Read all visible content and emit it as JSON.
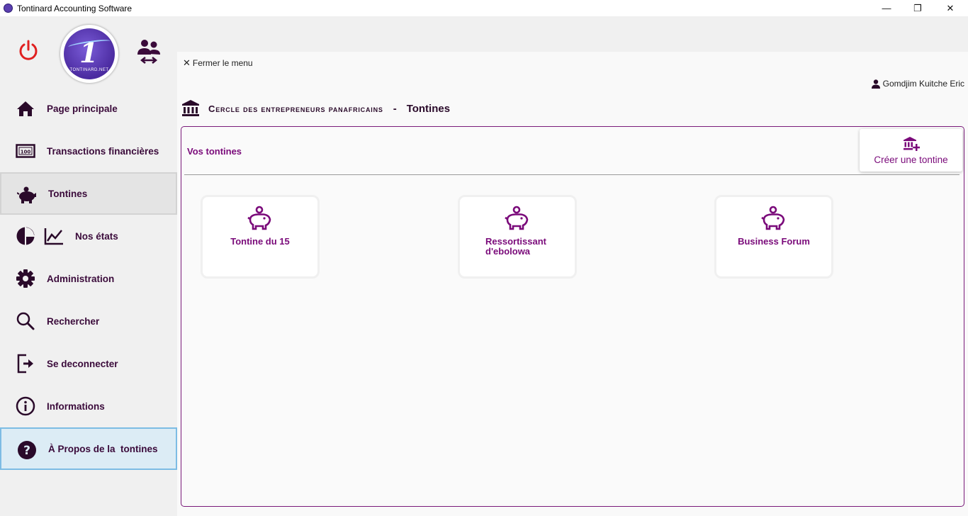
{
  "window": {
    "title": "Tontinard Accounting Software",
    "controls": {
      "minimize": "—",
      "restore": "❐",
      "close": "✕"
    }
  },
  "sidebar": {
    "logo_text": "TONTINARD.NET",
    "items": [
      {
        "label": "Page principale",
        "icon": "home-icon"
      },
      {
        "label": "Transactions financières",
        "icon": "banknote-icon"
      },
      {
        "label": "Tontines",
        "icon": "piggy-bank-icon",
        "state": "active"
      },
      {
        "label": "Nos états",
        "icon": "chart-icon"
      },
      {
        "label": "Administration",
        "icon": "gear-icon"
      },
      {
        "label": "Rechercher",
        "icon": "search-icon"
      },
      {
        "label": "Se deconnecter",
        "icon": "logout-icon"
      },
      {
        "label": "Informations",
        "icon": "info-icon"
      },
      {
        "label": "À Propos de la  tontines",
        "icon": "help-icon",
        "state": "selected"
      }
    ]
  },
  "main": {
    "close_menu": "Fermer le menu",
    "user_name": "Gomdjim Kuitche Eric",
    "org_name": "Cercle des entrepreneurs panafricains",
    "separator": "-",
    "section_title": "Tontines",
    "panel_title": "Vos tontines",
    "create_button": "Créer une tontine",
    "tontines": [
      {
        "name": "Tontine du 15"
      },
      {
        "name": "Ressortissant d'ebolowa"
      },
      {
        "name": "Business Forum"
      }
    ]
  },
  "colors": {
    "accent": "#7a0a7a",
    "nav_text": "#3a0a3a",
    "power": "#e02020",
    "selected_border": "#7dbce4"
  }
}
